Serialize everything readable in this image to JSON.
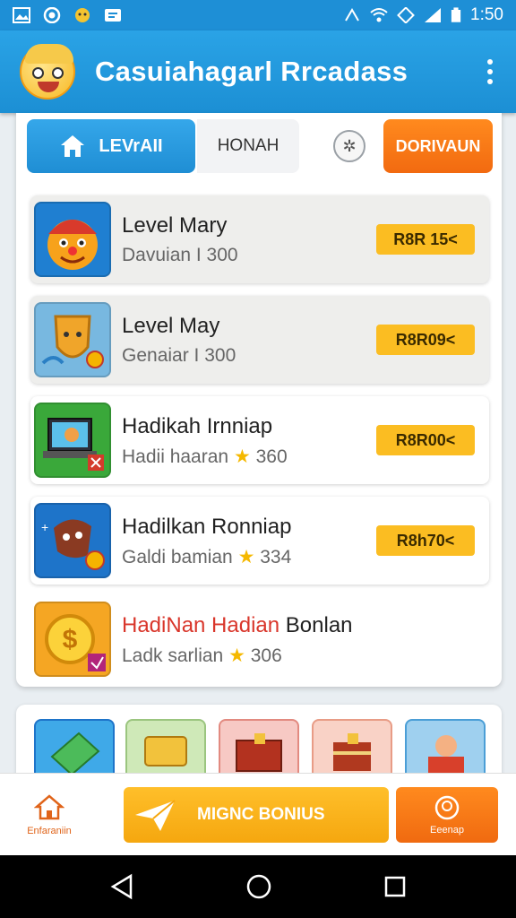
{
  "status_bar": {
    "time": "1:50"
  },
  "app_bar": {
    "title": "Casuiahagarl Rrcadass"
  },
  "tabs": {
    "active_label": "LEVrAII",
    "second_label": "HONAH",
    "action_label": "DORIVAUN"
  },
  "list": [
    {
      "title": "Level Mary",
      "subtitle": "Davuian I 300",
      "badge": "R8R 15<",
      "highlight": false
    },
    {
      "title": "Level May",
      "subtitle": "Genaiar I 300",
      "badge": "R8R09<",
      "highlight": false
    },
    {
      "title": "Hadikah Irnniap",
      "subtitle": "Hadii haaran",
      "rating": "360",
      "badge": "R8R00<",
      "highlight": false
    },
    {
      "title": "Hadilkan Ronniap",
      "subtitle": "Galdi bamian",
      "rating": "334",
      "badge": "R8h70<",
      "highlight": false
    },
    {
      "title_part1": "HadiNan Hadian",
      "title_part2": "Bonlan",
      "subtitle": "Ladk sarlian",
      "rating": "306",
      "highlight": true
    }
  ],
  "bottom_nav": {
    "home_label": "Enfaraniin",
    "bonus_label": "MIGNC BONIUS",
    "profile_label": "Eeenap"
  },
  "colors": {
    "primary": "#1e8fd6",
    "accent_orange": "#f26a10",
    "badge_yellow": "#fbbd22"
  }
}
